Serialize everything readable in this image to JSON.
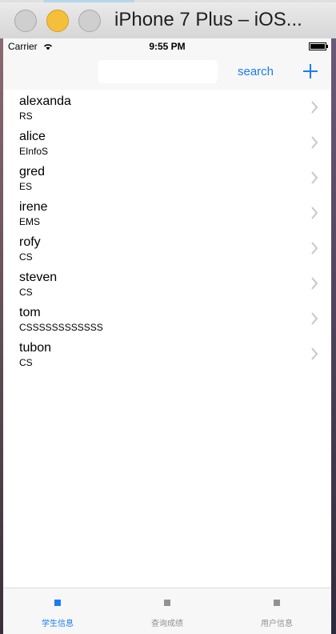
{
  "window": {
    "title": "iPhone 7 Plus – iOS..."
  },
  "status_bar": {
    "carrier": "Carrier",
    "time": "9:55 PM"
  },
  "nav": {
    "search_value": "",
    "search_label": "search",
    "add_icon": "plus-icon"
  },
  "students": [
    {
      "name": "alexanda",
      "dept": "RS"
    },
    {
      "name": "alice",
      "dept": "EInfoS"
    },
    {
      "name": "gred",
      "dept": "ES"
    },
    {
      "name": "irene",
      "dept": "EMS"
    },
    {
      "name": "rofy",
      "dept": "CS"
    },
    {
      "name": "steven",
      "dept": "CS"
    },
    {
      "name": "tom",
      "dept": "CSSSSSSSSSSSS"
    },
    {
      "name": "tubon",
      "dept": "CS"
    }
  ],
  "tabs": [
    {
      "label": "学生信息",
      "active": true
    },
    {
      "label": "查询成绩",
      "active": false
    },
    {
      "label": "用户信息",
      "active": false
    }
  ],
  "colors": {
    "accent": "#1b7cf0",
    "inactive": "#929292",
    "chevron": "#c7c7cc"
  }
}
